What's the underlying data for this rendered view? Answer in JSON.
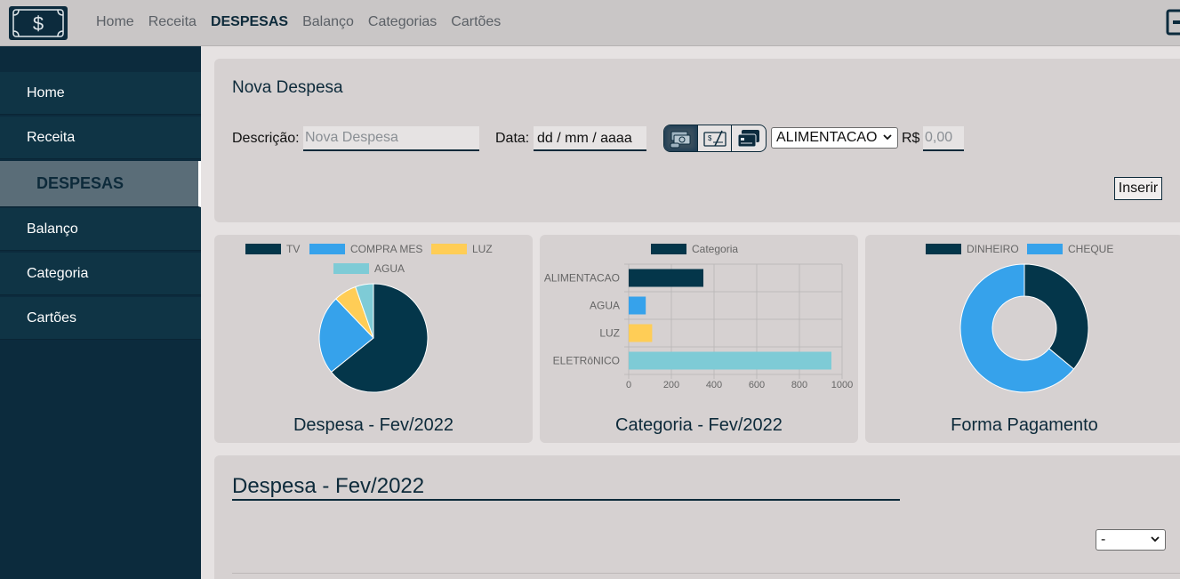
{
  "nav": {
    "items": [
      {
        "label": "Home",
        "active": false
      },
      {
        "label": "Receita",
        "active": false
      },
      {
        "label": "DESPESAS",
        "active": true
      },
      {
        "label": "Balanço",
        "active": false
      },
      {
        "label": "Categorias",
        "active": false
      },
      {
        "label": "Cartões",
        "active": false
      }
    ]
  },
  "sidebar": {
    "items": [
      {
        "label": "Home"
      },
      {
        "label": "Receita"
      },
      {
        "label": "DESPESAS",
        "active": true
      },
      {
        "label": "Balanço"
      },
      {
        "label": "Categoria"
      },
      {
        "label": "Cartões"
      }
    ]
  },
  "form": {
    "title": "Nova Despesa",
    "descricao_label": "Descrição:",
    "descricao_placeholder": "Nova Despesa",
    "data_label": "Data:",
    "data_placeholder": "dd / mm / aaaa",
    "payment_methods": [
      "dinheiro-icon",
      "cheque-icon",
      "cartao-icon"
    ],
    "payment_selected": "dinheiro",
    "category_selected": "ALIMENTACAO",
    "currency_label": "R$",
    "valor_placeholder": "0,00",
    "insert_label": "Inserir"
  },
  "colors": {
    "dark": "#04364a",
    "blue": "#36a2eb",
    "yellow": "#ffcd56",
    "teal": "#7ecbd6",
    "sidebar": "#0c2b3d"
  },
  "charts": {
    "despesa_title": "Despesa - Fev/2022",
    "categoria_title": "Categoria - Fev/2022",
    "pagamento_title": "Forma Pagamento"
  },
  "chart_data": [
    {
      "type": "pie",
      "title": "Despesa - Fev/2022",
      "legend_placement": "top",
      "labels": [
        "TV",
        "COMPRA MES",
        "LUZ",
        "AGUA"
      ],
      "values": [
        950,
        350,
        100,
        80
      ],
      "colors": [
        "#04364a",
        "#36a2eb",
        "#ffcd56",
        "#7ecbd6"
      ]
    },
    {
      "type": "bar",
      "orientation": "horizontal",
      "title": "Categoria - Fev/2022",
      "legend_placement": "top",
      "series": [
        {
          "name": "Categoria",
          "values": [
            350,
            80,
            110,
            950
          ]
        }
      ],
      "categories": [
        "ALIMENTACAO",
        "AGUA",
        "LUZ",
        "ELETRôNICO"
      ],
      "colors": [
        "#04364a",
        "#36a2eb",
        "#ffcd56",
        "#7ecbd6"
      ],
      "xlim": [
        0,
        1000
      ],
      "xticks": [
        "0",
        "200",
        "400",
        "600",
        "800",
        "1000"
      ],
      "grid": true
    },
    {
      "type": "pie",
      "variant": "doughnut",
      "title": "Forma Pagamento",
      "legend_placement": "top",
      "labels": [
        "DINHEIRO",
        "CHEQUE"
      ],
      "values": [
        36,
        64
      ],
      "colors": [
        "#04364a",
        "#36a2eb"
      ]
    }
  ],
  "list": {
    "title": "Despesa - Fev/2022",
    "filter_selected": "-"
  }
}
